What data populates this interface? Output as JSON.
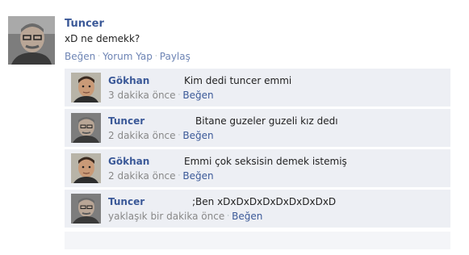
{
  "post": {
    "author": "Tuncer",
    "text": "xD ne demekk?",
    "actions": {
      "like": "Beğen",
      "comment": "Yorum Yap",
      "share": "Paylaş"
    }
  },
  "comments": [
    {
      "author": "Gökhan",
      "text": "Kim dedi tuncer emmi",
      "time": "3 dakika önce",
      "like": "Beğen",
      "avatar": "young-man"
    },
    {
      "author": "Tuncer",
      "text": "Bitane guzeler guzeli kız dedı",
      "time": "2 dakika önce",
      "like": "Beğen",
      "avatar": "older-man"
    },
    {
      "author": "Gökhan",
      "text": "Emmi çok seksisin demek istemiş",
      "time": "2 dakika önce",
      "like": "Beğen",
      "avatar": "young-man"
    },
    {
      "author": "Tuncer",
      "text": ";Ben xDxDxDxDxDxDxDxDxD",
      "time": "yaklaşık bir dakika önce",
      "like": "Beğen",
      "avatar": "older-man"
    }
  ],
  "colors": {
    "link": "#3b5998",
    "comment_bg": "#edeff4",
    "meta": "#888888"
  }
}
